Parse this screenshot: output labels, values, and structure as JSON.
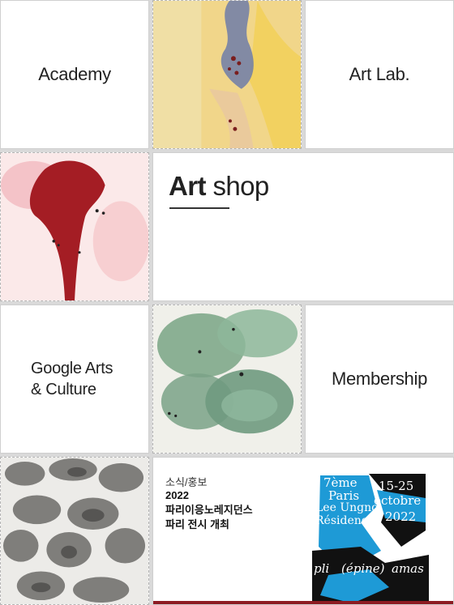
{
  "tiles": {
    "academy": "Academy",
    "art_lab": "Art Lab.",
    "art_shop": {
      "bold": "Art",
      "light": "shop"
    },
    "google_arts": [
      "Google Arts",
      "& Culture"
    ],
    "membership": "Membership"
  },
  "news": {
    "category": "소식/홍보",
    "title_lines": [
      "2022",
      "파리이응노레지던스",
      "파리 전시 개최"
    ]
  },
  "poster": {
    "lines": [
      "7ème",
      "Paris",
      "Lee Ungno",
      "Résidence",
      "15-25",
      "octobre",
      "2022"
    ],
    "tagline": [
      "pli",
      "(épine)",
      "amas"
    ]
  },
  "colors": {
    "accent_bar": "#8d1b22",
    "poster_blue": "#1e9ad6"
  }
}
